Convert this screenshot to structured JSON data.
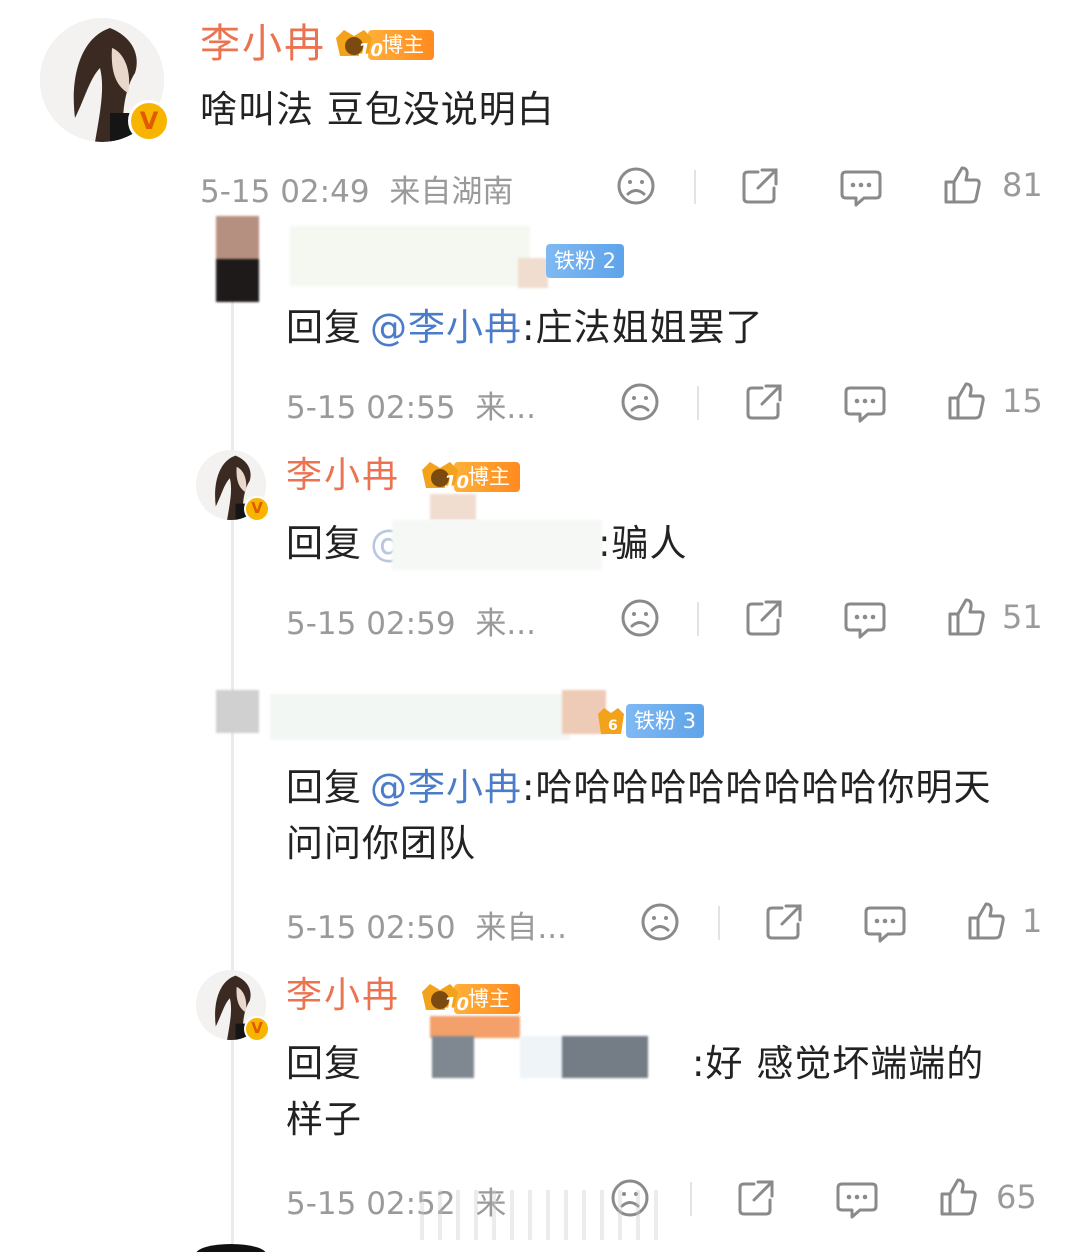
{
  "comment": {
    "author": "李小冉",
    "vip_level": "10",
    "vip_label": "博主",
    "text": "啥叫法 豆包没说明白",
    "time": "5-15 02:49",
    "location": "来自湖南",
    "likes": "81",
    "verified_mark": "V"
  },
  "replies": [
    {
      "fan_label": "铁粉 2",
      "prefix": "回复",
      "mention": "@李小冉",
      "body": ":庄法姐姐罢了",
      "time": "5-15 02:55",
      "location": "来...",
      "likes": "15"
    },
    {
      "author": "李小冉",
      "vip_level": "10",
      "vip_label": "博主",
      "prefix": "回复",
      "mention": "@",
      "body": ":骗人",
      "time": "5-15 02:59",
      "location": "来...",
      "likes": "51"
    },
    {
      "fan_label": "铁粉 3",
      "fan_level": "6",
      "prefix": "回复",
      "mention": "@李小冉",
      "body": ":哈哈哈哈哈哈哈哈哈你明天",
      "body2": "问问你团队",
      "time": "5-15 02:50",
      "location": "来自...",
      "likes": "1"
    },
    {
      "author": "李小冉",
      "vip_level": "10",
      "vip_label": "博主",
      "prefix": "回复",
      "body": ":好 感觉坏端端的",
      "body2": "样子",
      "time": "5-15 02:52",
      "location": "来",
      "likes": "65"
    }
  ],
  "colors": {
    "name": "#eb7350",
    "link": "#4a7cc9",
    "meta": "#9a9a9a",
    "vip_tag": "#ff9a2a",
    "fan_tag": "#6aaaee"
  },
  "icons": [
    "sad-face-icon",
    "share-icon",
    "comment-icon",
    "like-icon"
  ]
}
